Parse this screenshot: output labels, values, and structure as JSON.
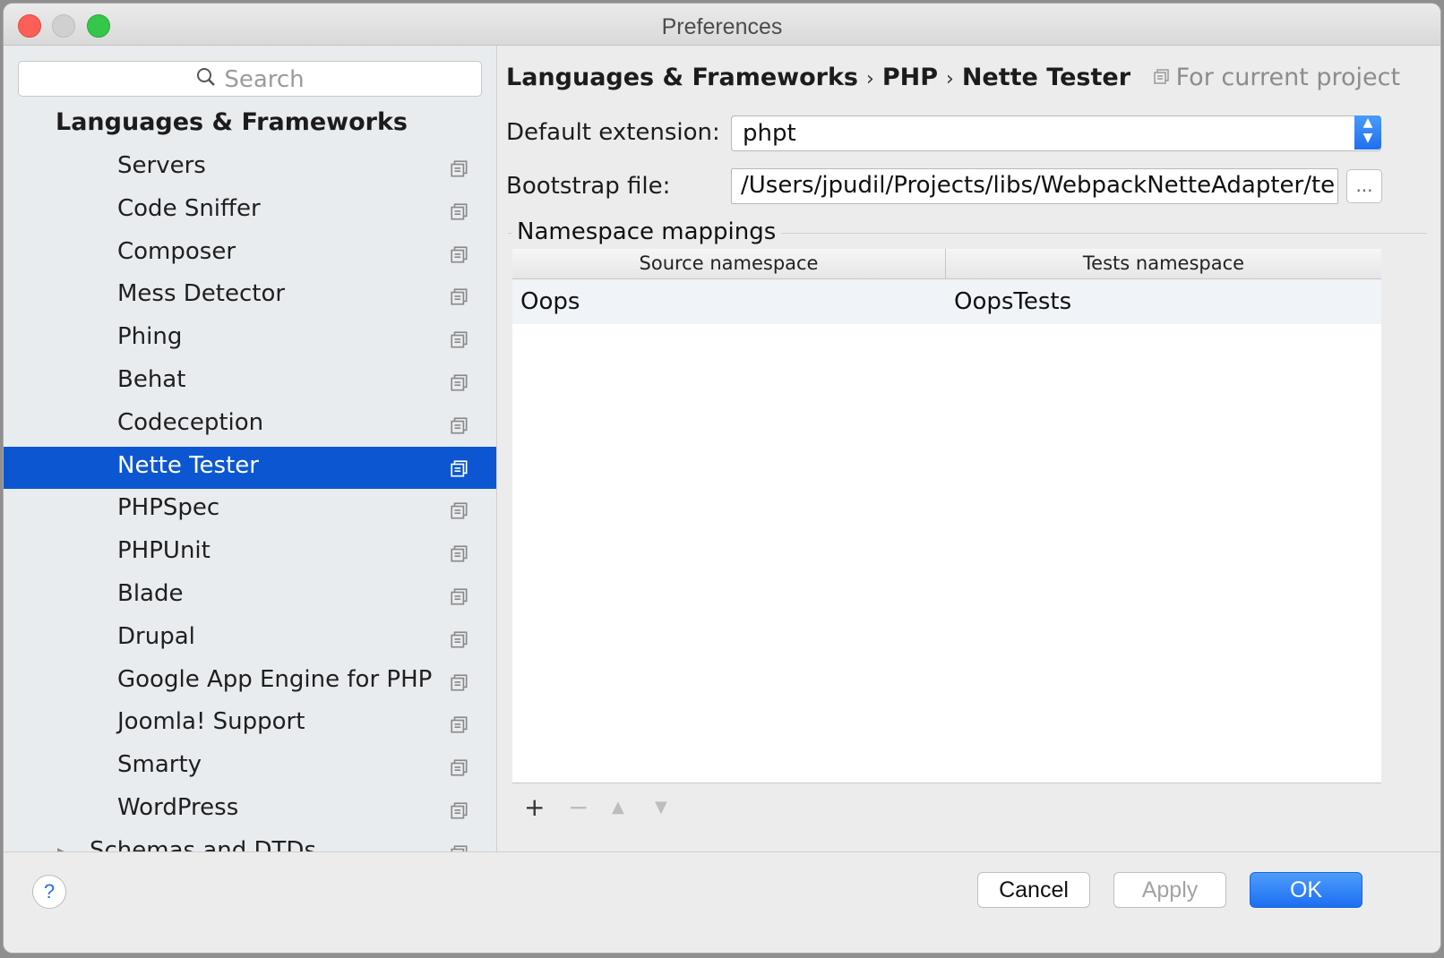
{
  "window": {
    "title": "Preferences"
  },
  "sidebar": {
    "search_placeholder": "Search",
    "group_title": "Languages & Frameworks",
    "items": [
      {
        "label": "Servers"
      },
      {
        "label": "Code Sniffer"
      },
      {
        "label": "Composer"
      },
      {
        "label": "Mess Detector"
      },
      {
        "label": "Phing"
      },
      {
        "label": "Behat"
      },
      {
        "label": "Codeception"
      },
      {
        "label": "Nette Tester",
        "selected": true
      },
      {
        "label": "PHPSpec"
      },
      {
        "label": "PHPUnit"
      },
      {
        "label": "Blade"
      },
      {
        "label": "Drupal"
      },
      {
        "label": "Google App Engine for PHP"
      },
      {
        "label": "Joomla! Support"
      },
      {
        "label": "Smarty"
      },
      {
        "label": "WordPress"
      },
      {
        "label": "Schemas and DTDs",
        "collapsed_tree": true
      }
    ],
    "icons": {
      "item_config": "project-config-icon",
      "tree_toggle": "triangle-right-icon"
    }
  },
  "main": {
    "breadcrumb": {
      "parts": [
        "Languages & Frameworks",
        "PHP",
        "Nette Tester"
      ],
      "separator": "›",
      "scope": "For current project"
    },
    "default_extension": {
      "label": "Default extension:",
      "value": "phpt"
    },
    "bootstrap_file": {
      "label": "Bootstrap file:",
      "value": "/Users/jpudil/Projects/libs/WebpackNetteAdapter/te",
      "browse_label": "..."
    },
    "namespace_mappings": {
      "title": "Namespace mappings",
      "columns": [
        "Source namespace",
        "Tests namespace"
      ],
      "rows": [
        {
          "source": "Oops",
          "tests": "OopsTests"
        }
      ],
      "toolbar": {
        "add": "+",
        "remove": "−",
        "up": "▲",
        "down": "▼"
      }
    }
  },
  "footer": {
    "help": "?",
    "cancel": "Cancel",
    "apply": "Apply",
    "ok": "OK"
  },
  "colors": {
    "selection": "#0c57d1",
    "accent": "#1e6ff0",
    "close": "#fc5f57",
    "maximize": "#34c749"
  }
}
